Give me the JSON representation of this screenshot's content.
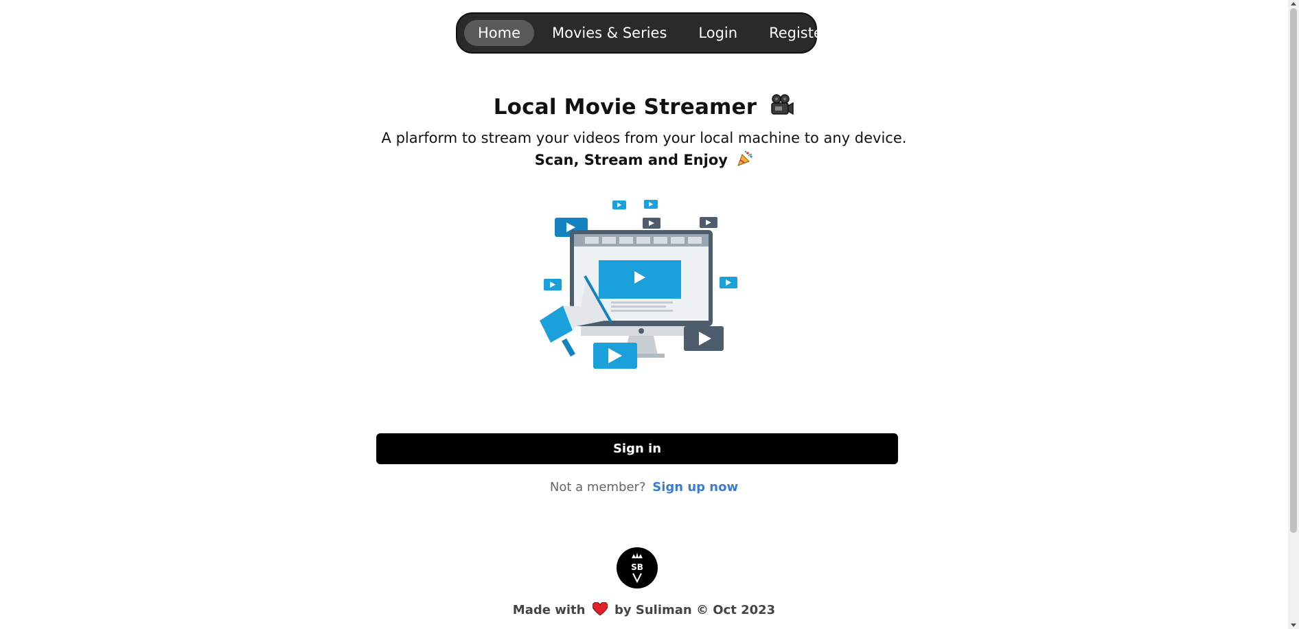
{
  "nav": {
    "items": [
      {
        "label": "Home",
        "active": true
      },
      {
        "label": "Movies & Series",
        "active": false
      },
      {
        "label": "Login",
        "active": false
      },
      {
        "label": "Register",
        "active": false
      }
    ]
  },
  "hero": {
    "title": "Local Movie Streamer",
    "subtitle": "A plarform to stream your videos from your local machine to any device.",
    "tagline": "Scan, Stream and Enjoy",
    "title_icon": "movie-camera-icon",
    "tagline_icon": "party-popper-icon"
  },
  "auth": {
    "signin_label": "Sign in",
    "member_text": "Not a member?",
    "signup_label": "Sign up now"
  },
  "footer": {
    "made_with": "Made with",
    "by_text": "by Suliman © Oct 2023",
    "logo_text": "SB"
  },
  "colors": {
    "nav_bg": "#2a2a2a",
    "nav_active": "#5a5a5a",
    "link": "#3a7bd5",
    "button_bg": "#000000",
    "illustration_blue": "#1aa1db",
    "illustration_slate": "#4d5d6e"
  }
}
